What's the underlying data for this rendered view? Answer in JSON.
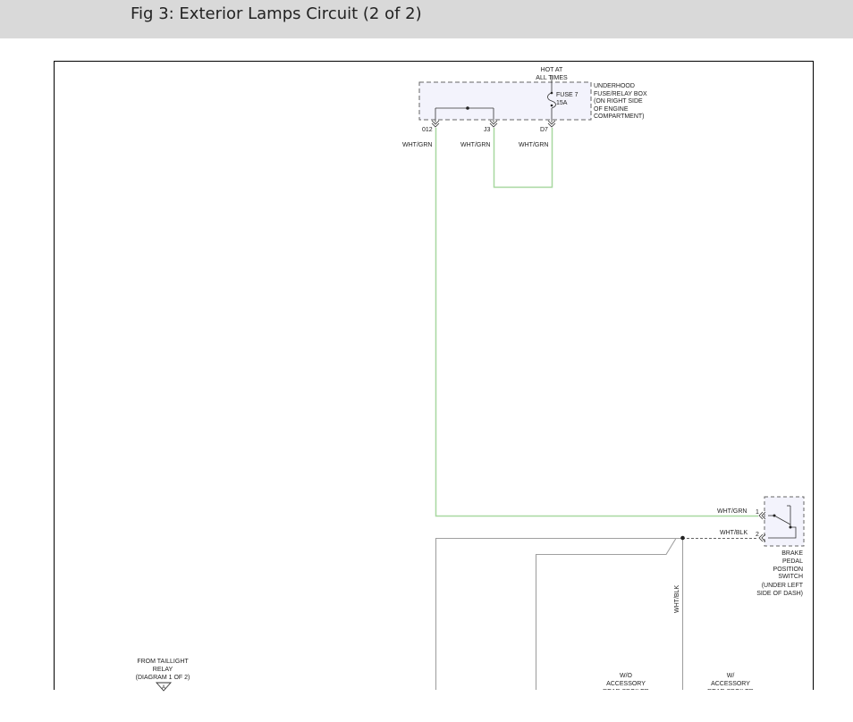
{
  "header": {
    "title": "Fig 3: Exterior Lamps Circuit (2 of 2)"
  },
  "colors": {
    "wire_green": "#a8d8a0",
    "wire_gray": "#a0a0a0",
    "component_fill": "#f3f3fc",
    "header_bg": "#d9d9d9"
  },
  "fuse_box": {
    "hot_label": [
      "HOT AT",
      "ALL TIMES"
    ],
    "name": [
      "UNDERHOOD",
      "FUSE/RELAY BOX",
      "(ON RIGHT SIDE",
      "OF ENGINE",
      "COMPARTMENT)"
    ],
    "fuse": [
      "FUSE 7",
      "15A"
    ],
    "terminals": [
      "012",
      "J3",
      "D7"
    ]
  },
  "wires": {
    "wht_grn": "WHT/GRN",
    "wht_blk": "WHT/BLK"
  },
  "brake_switch": {
    "pins": [
      "1",
      "2"
    ],
    "name": [
      "BRAKE",
      "PEDAL",
      "POSITION",
      "SWITCH"
    ],
    "location": [
      "(UNDER LEFT",
      "SIDE OF DASH)"
    ]
  },
  "taillight_ref": [
    "FROM TAILLIGHT",
    "RELAY",
    "(DIAGRAM 1 OF 2)"
  ],
  "taillight_connector": "A",
  "spoiler_options": {
    "without": [
      "W/O",
      "ACCESSORY",
      "REAR SPOILER"
    ],
    "with": [
      "W/",
      "ACCESSORY",
      "REAR SPOILER"
    ]
  }
}
